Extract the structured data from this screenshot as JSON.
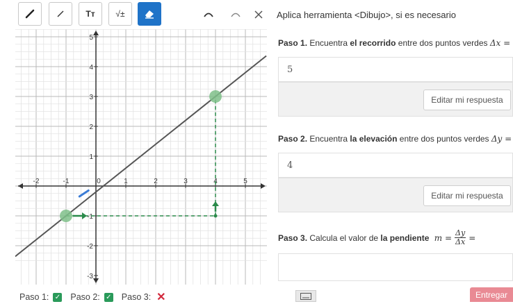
{
  "toolbar": {
    "tools": [
      {
        "name": "pencil-tool",
        "icon": "pencil-icon"
      },
      {
        "name": "line-tool",
        "icon": "line-icon"
      },
      {
        "name": "text-tool",
        "label": "Tт",
        "icon": "text-icon"
      },
      {
        "name": "math-tool",
        "label": "√±",
        "icon": "math-icon"
      },
      {
        "name": "eraser-tool",
        "icon": "eraser-icon",
        "active": true
      }
    ],
    "undo": "undo-icon",
    "redo": "redo-icon",
    "clear": "close-icon"
  },
  "instruction": "Aplica herramienta <Dibujo>, si es necesario",
  "steps": [
    {
      "prefix": "Paso 1.",
      "text_a": " Encuentra ",
      "bold": "el recorrido",
      "text_b": " entre dos puntos verdes ",
      "math": "Δx =",
      "answer": "5",
      "edit_label": "Editar mi respuesta"
    },
    {
      "prefix": "Paso 2.",
      "text_a": " Encuentra ",
      "bold": "la elevación",
      "text_b": " entre dos puntos verdes ",
      "math": "Δy =",
      "answer": "4",
      "edit_label": "Editar mi respuesta"
    },
    {
      "prefix": "Paso 3.",
      "text_a": " Calcula el valor de ",
      "bold": "la pendiente",
      "text_b": " ",
      "math_m": "m =",
      "frac_num": "Δy",
      "frac_den": "Δx",
      "math_eq": "=",
      "answer": ""
    }
  ],
  "graph": {
    "x_ticks": [
      "-2",
      "-1",
      "0",
      "1",
      "2",
      "3",
      "4",
      "5"
    ],
    "y_ticks": [
      "5",
      "4",
      "3",
      "2",
      "1",
      "-1",
      "-2",
      "-3"
    ],
    "points": [
      {
        "x": -1,
        "y": -1
      },
      {
        "x": 4,
        "y": 3
      }
    ],
    "colors": {
      "line": "#555555",
      "point": "#7fbf8a",
      "dashed": "#2a8a4a",
      "arrow": "#2a8a4a"
    }
  },
  "status": {
    "step1": "Paso 1:",
    "step2": "Paso 2:",
    "step3": "Paso 3:",
    "step1_state": "done",
    "step2_state": "done",
    "step3_state": "incomplete"
  },
  "submit_label": "Entregar",
  "keyboard": "keyboard-icon"
}
